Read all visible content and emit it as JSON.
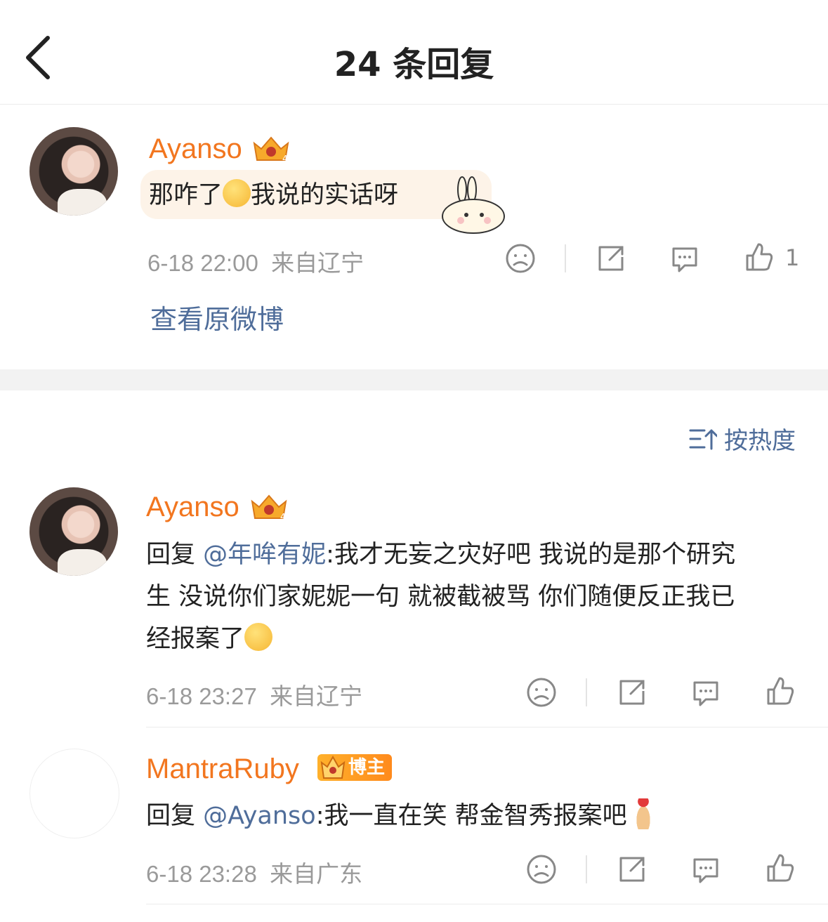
{
  "header": {
    "title": "24 条回复"
  },
  "root_comment": {
    "username": "Ayanso",
    "text_before_emoji": "那咋了",
    "text_after_emoji": "我说的实话呀",
    "time": "6-18 22:00",
    "location": "来自辽宁",
    "likes": "1",
    "view_original": "查看原微博"
  },
  "sort": {
    "label": "按热度"
  },
  "replies": [
    {
      "username": "Ayanso",
      "reply_prefix": "回复 ",
      "mention": "@年哞有妮",
      "line1": ":我才无妄之灾好吧 我说的是那个研究",
      "line2": "生 没说你们家妮妮一句 就被截被骂 你们随便反正我已",
      "line3": "经报案了",
      "time": "6-18 23:27",
      "location": "来自辽宁"
    },
    {
      "username": "MantraRuby",
      "badge": "博主",
      "reply_prefix": "回复 ",
      "mention": "@Ayanso",
      "text": ":我一直在笑 帮金智秀报案吧",
      "time": "6-18 23:28",
      "location": "来自广东"
    }
  ]
}
